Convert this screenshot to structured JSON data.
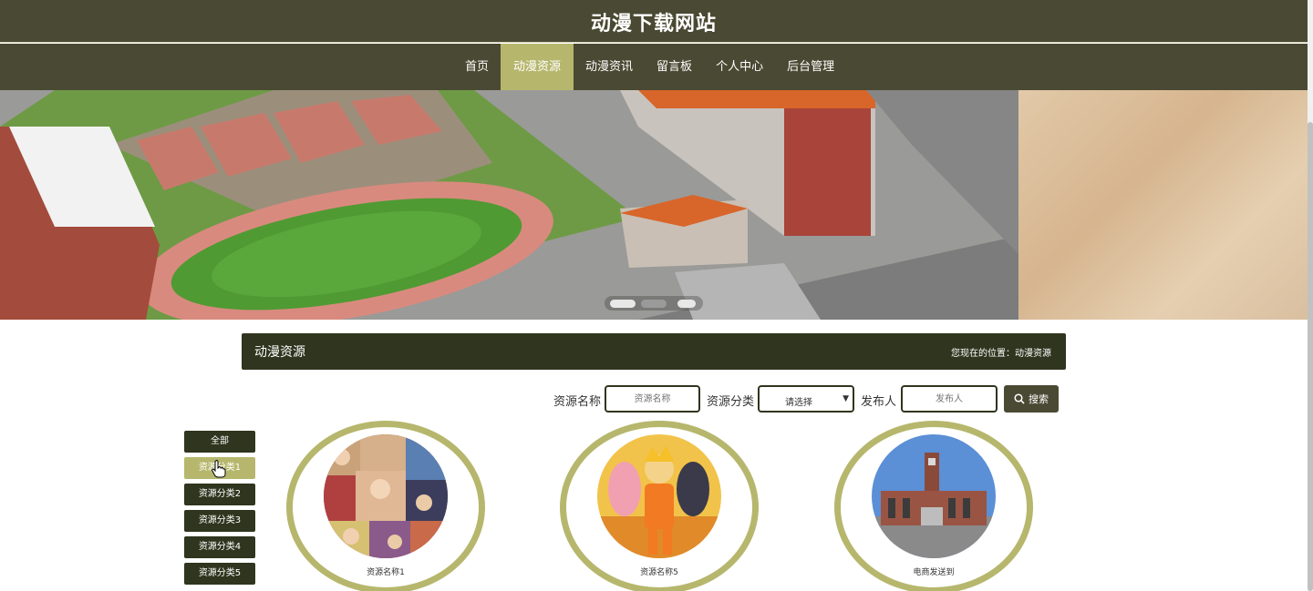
{
  "site": {
    "title": "动漫下载网站"
  },
  "nav": {
    "items": [
      {
        "label": "首页"
      },
      {
        "label": "动漫资源",
        "active": true
      },
      {
        "label": "动漫资讯"
      },
      {
        "label": "留言板"
      },
      {
        "label": "个人中心"
      },
      {
        "label": "后台管理"
      }
    ]
  },
  "banner": {
    "slide_count": 3,
    "active_slide": 2
  },
  "section": {
    "title": "动漫资源",
    "breadcrumb": "您现在的位置：动漫资源"
  },
  "search": {
    "name_label": "资源名称",
    "name_placeholder": "资源名称",
    "category_label": "资源分类",
    "category_value": "请选择",
    "publisher_label": "发布人",
    "publisher_placeholder": "发布人",
    "button_label": "搜索"
  },
  "categories": [
    {
      "label": "全部"
    },
    {
      "label": "资源分类1",
      "active": true
    },
    {
      "label": "资源分类2"
    },
    {
      "label": "资源分类3"
    },
    {
      "label": "资源分类4"
    },
    {
      "label": "资源分类5"
    }
  ],
  "resources": [
    {
      "name": "资源名称1",
      "image": "anime-collage"
    },
    {
      "name": "资源名称5",
      "image": "naruto"
    },
    {
      "name": "电商发送到",
      "image": "school-building"
    }
  ],
  "colors": {
    "header": "#4a4933",
    "accent": "#b6b76d",
    "dark": "#2f351e"
  }
}
